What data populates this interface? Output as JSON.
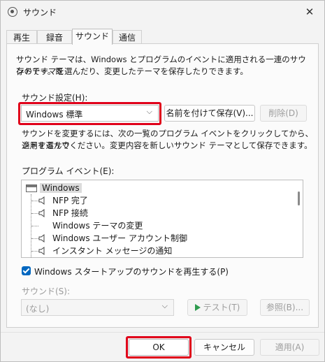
{
  "window": {
    "title": "サウンド",
    "close_glyph": "✕"
  },
  "tabs": [
    {
      "label": "再生"
    },
    {
      "label": "録音"
    },
    {
      "label": "サウンド"
    },
    {
      "label": "通信"
    }
  ],
  "active_tab": "サウンド",
  "description": {
    "line1": "サウンド テーマは、Windows とプログラムのイベントに適用される一連のサウンドです。既",
    "line2": "存のテーマを選んだり、変更したテーマを保存したりできます。"
  },
  "scheme": {
    "label": "サウンド設定(H):",
    "selected": "Windows 標準",
    "save_as": "名前を付けて保存(V)...",
    "delete": "削除(D)"
  },
  "instructions": {
    "line1": "サウンドを変更するには、次の一覧のプログラム イベントをクリックしてから、適用するサウ",
    "line2": "ンドを選んでください。変更内容を新しいサウンド テーマとして保存できます。"
  },
  "events": {
    "label": "プログラム イベント(E):",
    "root": "Windows",
    "items": [
      {
        "label": "NFP 完了",
        "has_sound": true
      },
      {
        "label": "NFP 接続",
        "has_sound": true
      },
      {
        "label": "Windows テーマの変更",
        "has_sound": false
      },
      {
        "label": "Windows ユーザー アカウント制御",
        "has_sound": true
      },
      {
        "label": "インスタント メッセージの通知",
        "has_sound": true
      }
    ]
  },
  "startup_sound": {
    "label": "Windows スタートアップのサウンドを再生する(P)",
    "checked": true
  },
  "sounds": {
    "label": "サウンド(S):",
    "selected": "(なし)",
    "test": "テスト(T)",
    "browse": "参照(B)..."
  },
  "footer": {
    "ok": "OK",
    "cancel": "キャンセル",
    "apply": "適用(A)"
  },
  "colors": {
    "accent": "#0067c0",
    "highlight_border": "#e0001a",
    "play_icon": "#2e9b4e"
  },
  "icons": {
    "title": "speaker-icon",
    "root": "window-icon",
    "event": "speaker-icon",
    "play": "play-icon",
    "chevron": "chevron-down-icon"
  }
}
